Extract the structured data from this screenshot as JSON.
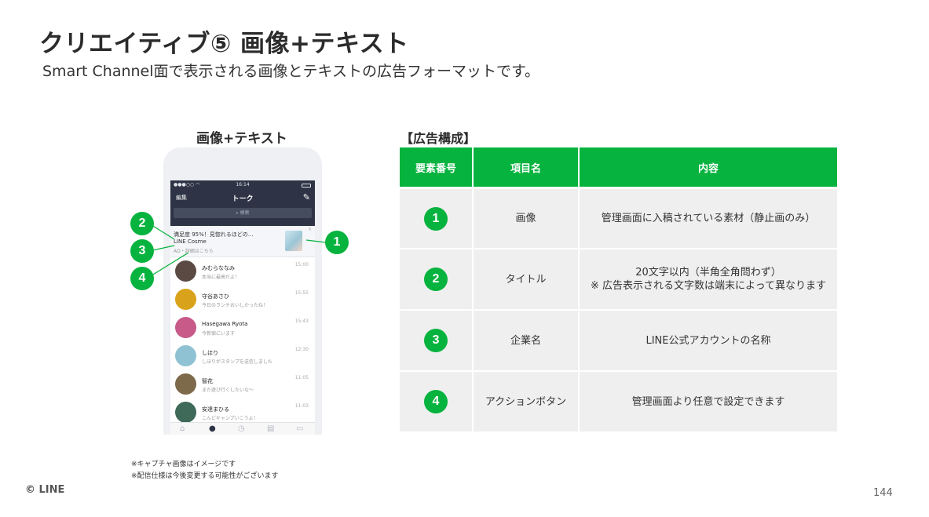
{
  "slide": {
    "title": "クリエイティブ⑤ 画像+テキスト",
    "subtitle": "Smart Channel面で表示される画像とテキストの広告フォーマットです。",
    "page_number": "144",
    "logo": "© LINE"
  },
  "phone": {
    "caption": "画像+テキスト",
    "status_time": "16:14",
    "edit_label": "編集",
    "header_title": "トーク",
    "search_placeholder": "検索",
    "ad": {
      "title": "満足度 95%！見惚れるほどの…",
      "company": "LINE Cosme",
      "action": "AD・詳細はこちら",
      "close": "×"
    },
    "chats": [
      {
        "name": "みむらななみ",
        "message": "本当に最高だよ！",
        "time": "15:00",
        "color": "#5b4a44"
      },
      {
        "name": "守谷あさひ",
        "message": "今日のランチおいしかったね！",
        "time": "15:55",
        "color": "#d9a21b"
      },
      {
        "name": "Hasegawa Ryota",
        "message": "今新宿にいます",
        "time": "15:43",
        "color": "#c85a8a"
      },
      {
        "name": "しほり",
        "message": "しほりがスタンプを送信しました",
        "time": "12:30",
        "color": "#8fc3d3"
      },
      {
        "name": "智花",
        "message": "また遊び行くしたいな〜",
        "time": "11:05",
        "color": "#7c6a4a"
      },
      {
        "name": "安達まひる",
        "message": "こんどキャンプいこうよ！",
        "time": "11:03",
        "color": "#3f6a5a"
      }
    ],
    "markers": [
      "1",
      "2",
      "3",
      "4"
    ]
  },
  "table": {
    "caption": "【広告構成】",
    "headers": [
      "要素番号",
      "項目名",
      "内容"
    ],
    "rows": [
      {
        "num": "1",
        "item": "画像",
        "content": "管理画面に入稿されている素材（静止画のみ）",
        "content2": ""
      },
      {
        "num": "2",
        "item": "タイトル",
        "content": "20文字以内（半角全角問わず）",
        "content2": "※ 広告表示される文字数は端末によって異なります"
      },
      {
        "num": "3",
        "item": "企業名",
        "content": "LINE公式アカウントの名称",
        "content2": ""
      },
      {
        "num": "4",
        "item": "アクションボタン",
        "content": "管理画面より任意で設定できます",
        "content2": ""
      }
    ]
  },
  "notes": [
    "※キャプチャ画像はイメージです",
    "※配信仕様は今後変更する可能性がございます"
  ],
  "colors": {
    "accent": "#06b33e",
    "header_bar": "#2e3445",
    "cell_bg": "#efefef"
  }
}
